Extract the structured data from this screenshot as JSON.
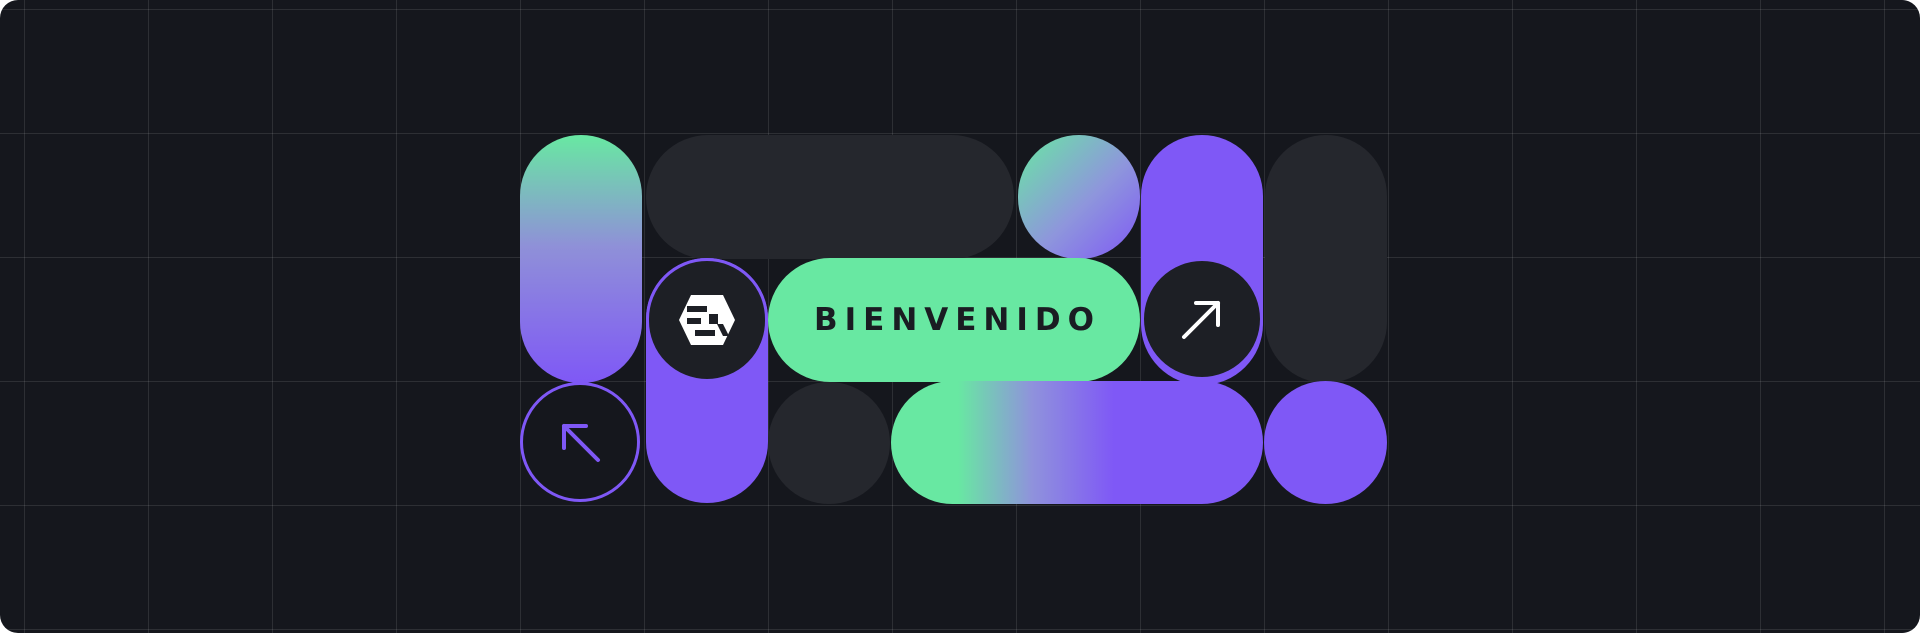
{
  "banner": {
    "welcome_text": "BIENVENIDO"
  },
  "icons": {
    "logo": "brand-logo-icon",
    "arrow_up_right": "arrow-up-right-icon",
    "arrow_up_left": "arrow-up-left-icon"
  },
  "colors": {
    "background": "#15171d",
    "grid_line": "#2f3138",
    "green": "#68e8a2",
    "purple": "#7f58f6",
    "dark_shape": "#25272d",
    "text_dark": "#1a1c22",
    "icon_white": "#ffffff"
  }
}
